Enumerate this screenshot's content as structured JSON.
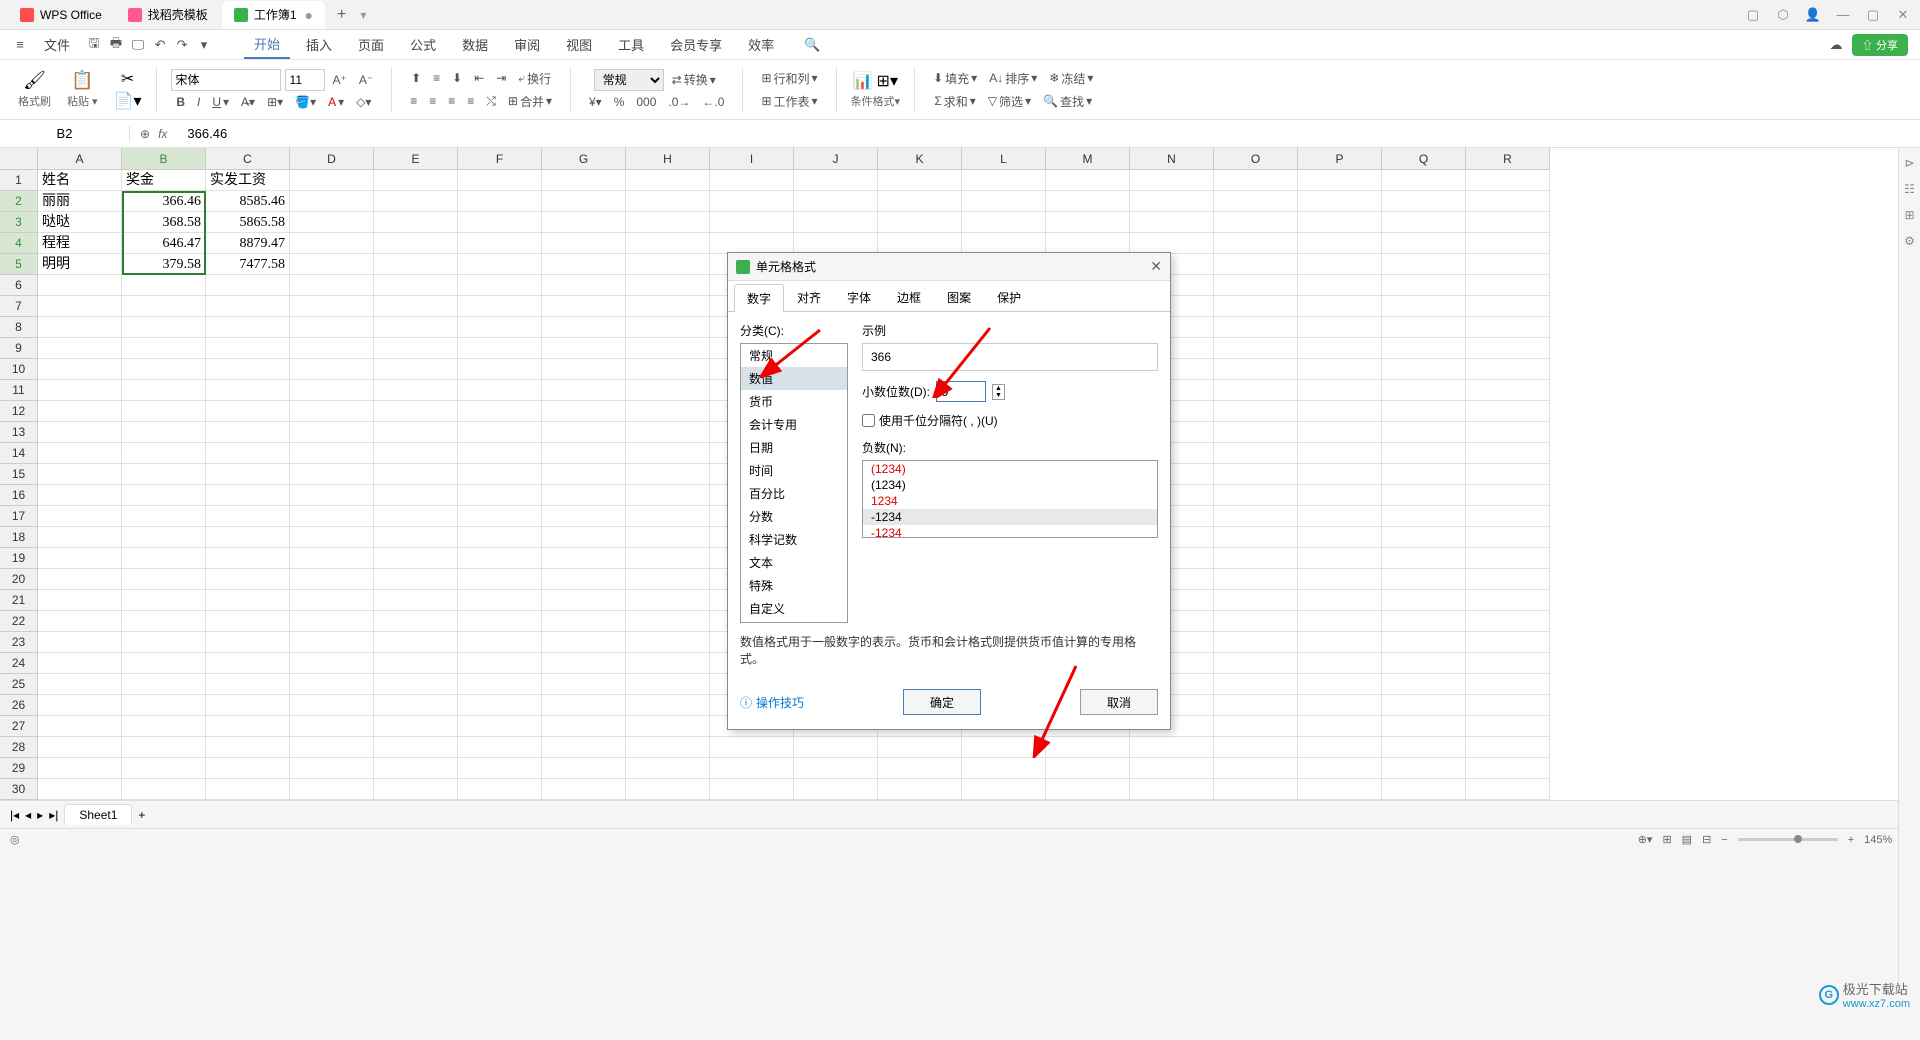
{
  "titlebar": {
    "tabs": [
      {
        "icon": "w",
        "label": "WPS Office"
      },
      {
        "icon": "d",
        "label": "找稻壳模板"
      },
      {
        "icon": "s",
        "label": "工作簿1"
      }
    ]
  },
  "menubar": {
    "file": "文件",
    "items": [
      "开始",
      "插入",
      "页面",
      "公式",
      "数据",
      "审阅",
      "视图",
      "工具",
      "会员专享",
      "效率"
    ],
    "share": "分享"
  },
  "toolbar": {
    "format_painter": "格式刷",
    "paste": "粘贴",
    "font_name": "宋体",
    "font_size": "11",
    "wrap": "换行",
    "format_general": "常规",
    "convert": "转换",
    "rowcol": "行和列",
    "worksheet": "工作表",
    "cond_format": "条件格式",
    "fill": "填充",
    "sort": "排序",
    "freeze": "冻结",
    "sum": "求和",
    "filter": "筛选",
    "find": "查找",
    "merge": "合并"
  },
  "refbar": {
    "cell": "B2",
    "formula": "366.46"
  },
  "columns": [
    "A",
    "B",
    "C",
    "D",
    "E",
    "F",
    "G",
    "H",
    "I",
    "J",
    "K",
    "L",
    "M",
    "N",
    "O",
    "P",
    "Q",
    "R"
  ],
  "rows_count": 30,
  "selected_rows": [
    2,
    3,
    4,
    5
  ],
  "data": {
    "headers": [
      "姓名",
      "奖金",
      "实发工资"
    ],
    "rows": [
      [
        "丽丽",
        "366.46",
        "8585.46"
      ],
      [
        "哒哒",
        "368.58",
        "5865.58"
      ],
      [
        "程程",
        "646.47",
        "8879.47"
      ],
      [
        "明明",
        "379.58",
        "7477.58"
      ]
    ]
  },
  "sheet_tabs": {
    "sheet1": "Sheet1"
  },
  "statusbar": {
    "cr": "◎",
    "zoom": "145%"
  },
  "dialog": {
    "title": "单元格格式",
    "tabs": [
      "数字",
      "对齐",
      "字体",
      "边框",
      "图案",
      "保护"
    ],
    "category_label": "分类(C):",
    "categories": [
      "常规",
      "数值",
      "货币",
      "会计专用",
      "日期",
      "时间",
      "百分比",
      "分数",
      "科学记数",
      "文本",
      "特殊",
      "自定义"
    ],
    "example_label": "示例",
    "example_value": "366",
    "decimal_label": "小数位数(D):",
    "decimal_value": "0",
    "thousand_sep": "使用千位分隔符( , )(U)",
    "negative_label": "负数(N):",
    "negatives": [
      "(1234)",
      "(1234)",
      "1234",
      "-1234",
      "-1234"
    ],
    "description": "数值格式用于一般数字的表示。货币和会计格式则提供货币值计算的专用格式。",
    "help": "操作技巧",
    "ok": "确定",
    "cancel": "取消"
  },
  "watermark": {
    "brand": "极光下载站",
    "url": "www.xz7.com"
  }
}
